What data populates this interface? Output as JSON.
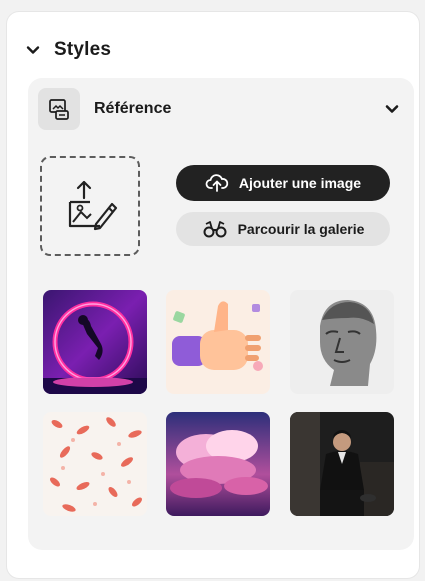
{
  "section": {
    "title": "Styles",
    "expanded": true
  },
  "reference": {
    "label": "Référence",
    "icon": "reference-image-icon"
  },
  "upload": {
    "dropzone_icon": "image-upload-icon",
    "add_image_label": "Ajouter une image",
    "add_image_icon": "cloud-upload-icon",
    "browse_gallery_label": "Parcourir la galerie",
    "browse_gallery_icon": "binoculars-icon"
  },
  "gallery": [
    {
      "name": "neon-figure"
    },
    {
      "name": "thumbs-up"
    },
    {
      "name": "classical-bust"
    },
    {
      "name": "pattern-leaves"
    },
    {
      "name": "pink-clouds"
    },
    {
      "name": "man-portrait"
    }
  ],
  "colors": {
    "panel_bg": "#ffffff",
    "card_bg": "#f3f3f3",
    "primary_button": "#222222",
    "secondary_button": "#e3e3e3"
  }
}
